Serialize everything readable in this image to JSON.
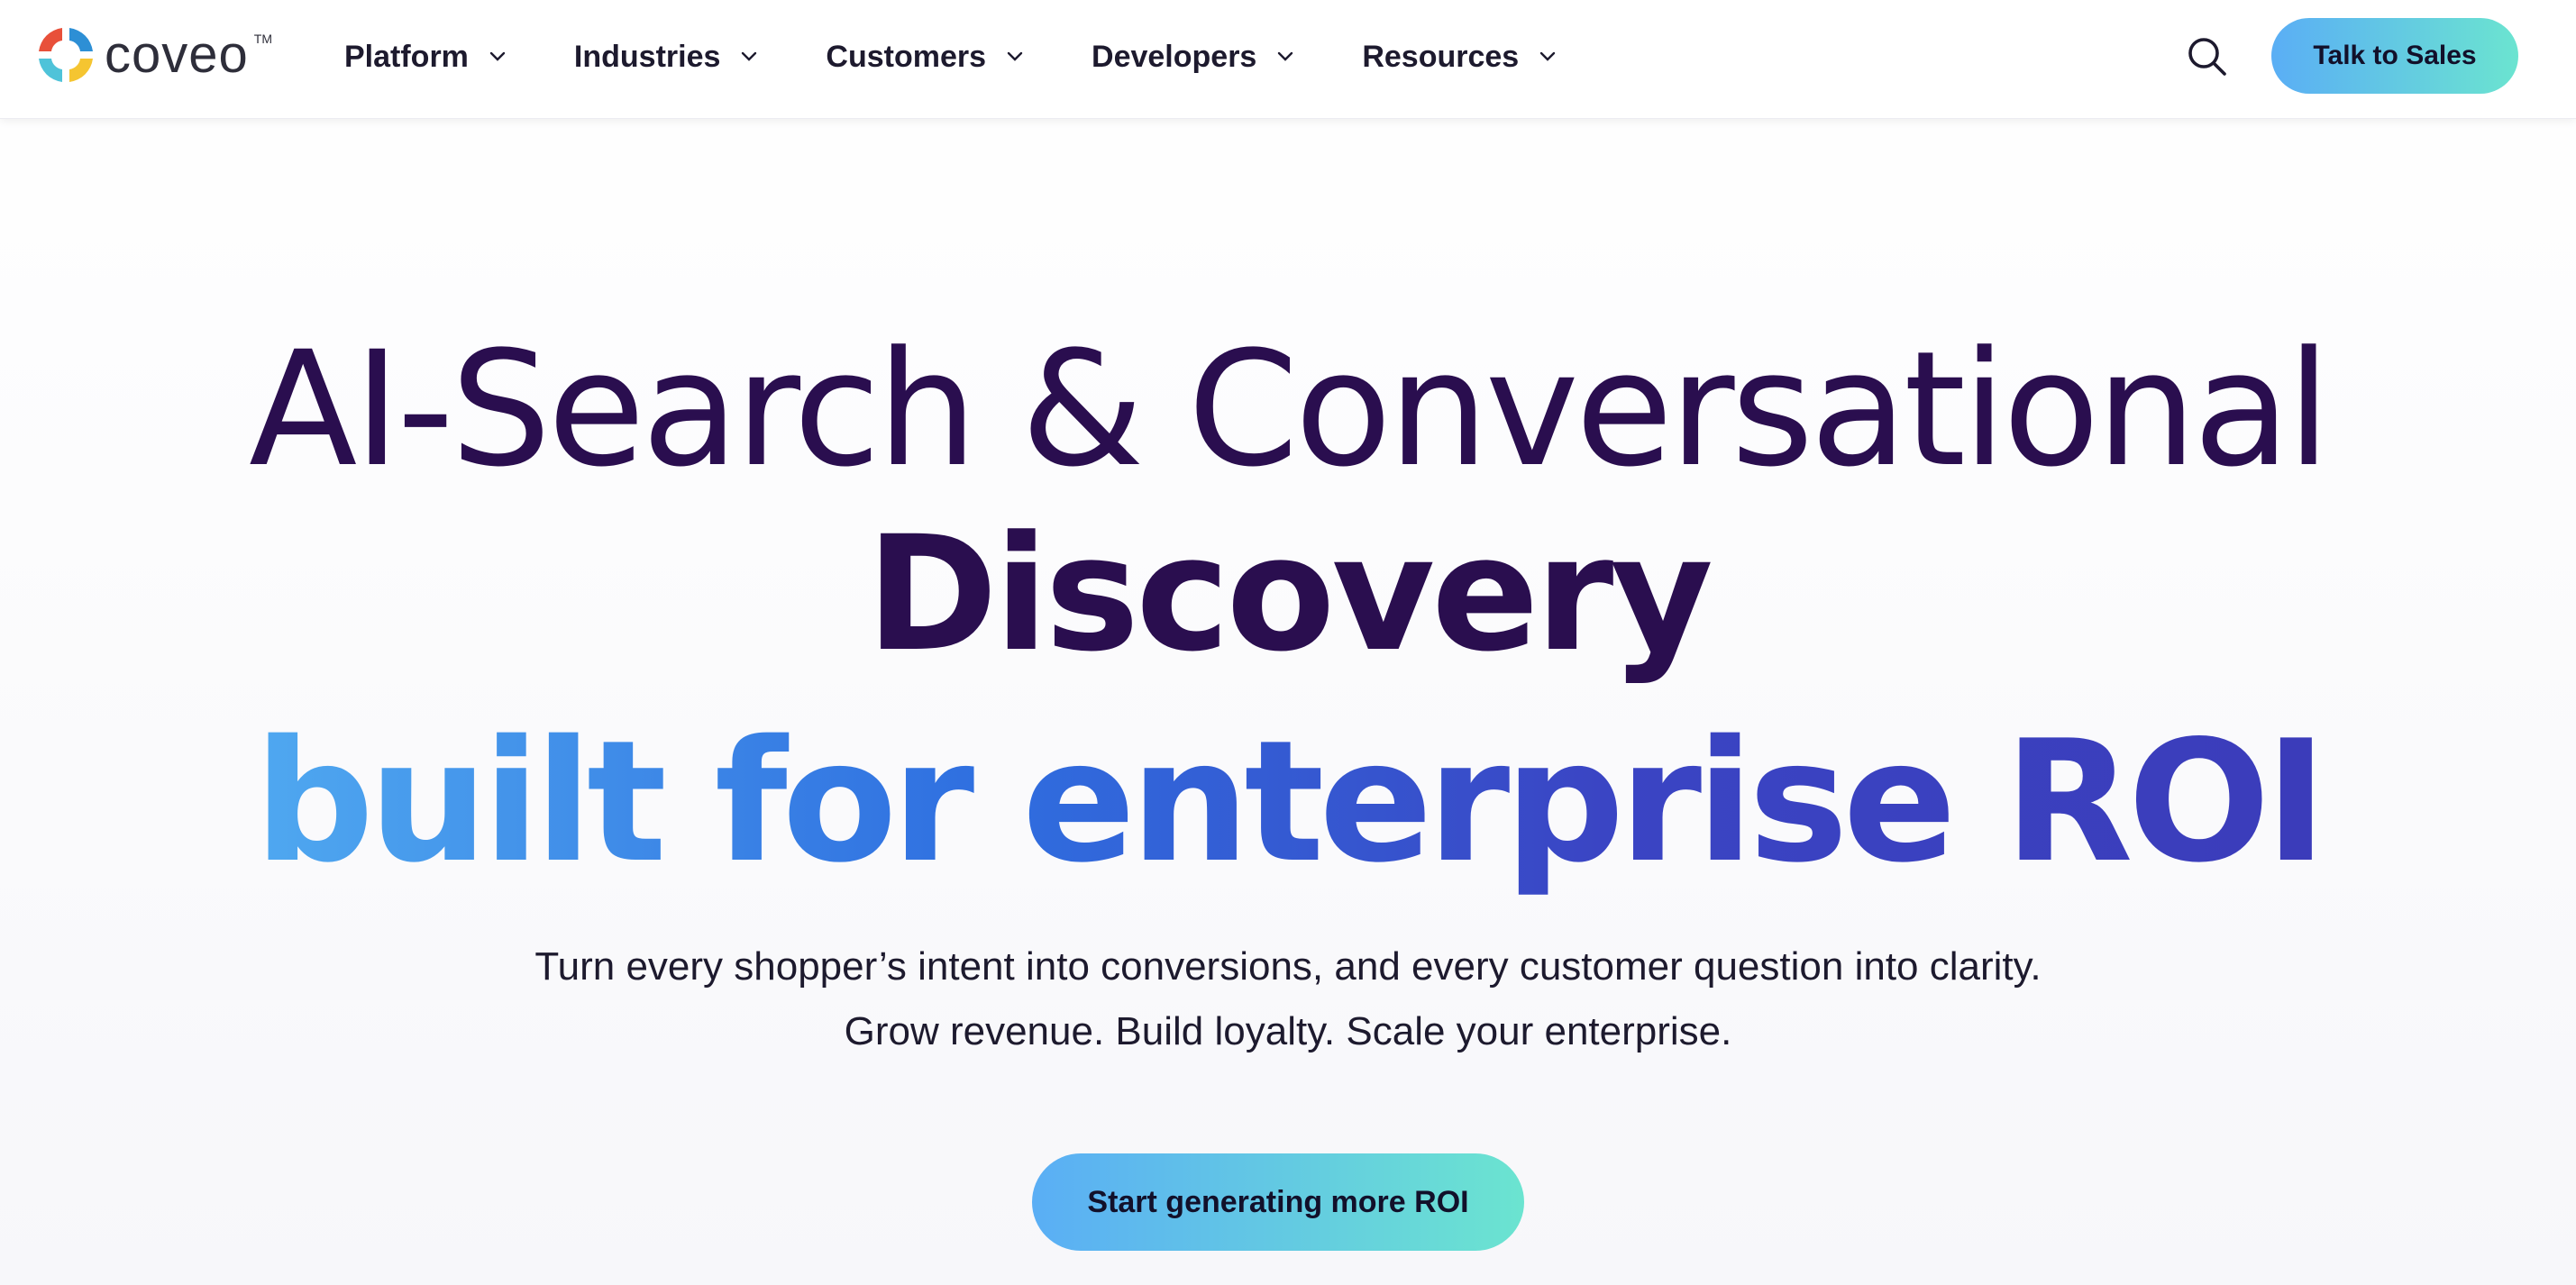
{
  "brand": {
    "name": "coveo",
    "trademark": "TM",
    "logo_icon": "coveo-logo-icon",
    "logo_colors": [
      "#e8503a",
      "#f5c531",
      "#4fc3d9",
      "#2d8fd5"
    ]
  },
  "nav": {
    "items": [
      {
        "label": "Platform",
        "icon": "chevron-down-icon"
      },
      {
        "label": "Industries",
        "icon": "chevron-down-icon"
      },
      {
        "label": "Customers",
        "icon": "chevron-down-icon"
      },
      {
        "label": "Developers",
        "icon": "chevron-down-icon"
      },
      {
        "label": "Resources",
        "icon": "chevron-down-icon"
      }
    ],
    "search_icon": "search-icon",
    "cta_label": "Talk to Sales"
  },
  "hero": {
    "line1": "AI-Search & Conversational",
    "line2": "Discovery",
    "line3": "built for enterprise ROI",
    "subtitle_line1": "Turn every shopper’s intent into conversions, and every customer question into clarity.",
    "subtitle_line2": "Grow revenue. Build loyalty. Scale your enterprise.",
    "cta_label": "Start generating more ROI"
  },
  "colors": {
    "heading": "#2a0e4f",
    "gradient_start": "#4fa8f0",
    "gradient_end": "#3b3cba",
    "button_gradient_start": "#5aaef5",
    "button_gradient_end": "#6be4d0"
  }
}
